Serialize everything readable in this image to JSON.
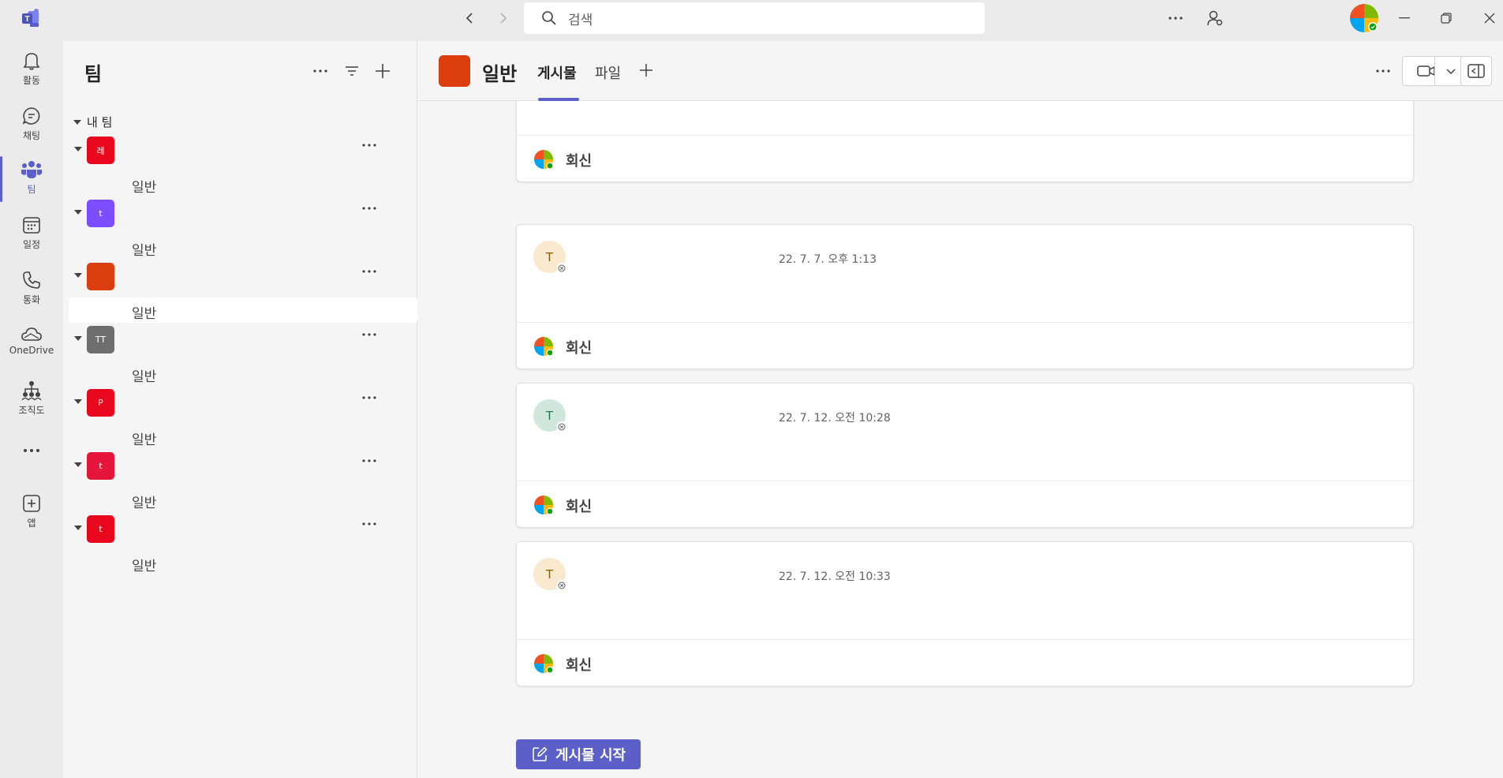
{
  "titlebar": {
    "search_placeholder": "검색"
  },
  "rail": {
    "items": [
      {
        "label": "활동",
        "icon": "bell-icon"
      },
      {
        "label": "채팅",
        "icon": "chat-icon"
      },
      {
        "label": "팀",
        "icon": "teams-icon"
      },
      {
        "label": "일정",
        "icon": "calendar-icon"
      },
      {
        "label": "통화",
        "icon": "phone-icon"
      },
      {
        "label": "OneDrive",
        "icon": "cloud-icon"
      },
      {
        "label": "조직도",
        "icon": "org-chart-icon"
      },
      {
        "label": "",
        "icon": "more-icon"
      },
      {
        "label": "앱",
        "icon": "add-app-icon"
      }
    ],
    "active_index": 2,
    "accent_color": "#5b5fc7"
  },
  "teams_panel": {
    "title": "팀",
    "section_label": "내 팀",
    "teams": [
      {
        "initials": "레",
        "color": "#e8071c",
        "channel": "일반"
      },
      {
        "initials": "t",
        "color": "#7c4dff",
        "channel": "일반"
      },
      {
        "initials": "",
        "color": "#dc3d0e",
        "channel": "일반"
      },
      {
        "initials": "TT",
        "color": "#6e6e6e",
        "channel": "일반"
      },
      {
        "initials": "P",
        "color": "#e8071c",
        "channel": "일반"
      },
      {
        "initials": "t",
        "color": "#e5153c",
        "channel": "일반"
      },
      {
        "initials": "t",
        "color": "#e8071c",
        "channel": "일반"
      }
    ],
    "selected_team_index": 2
  },
  "channel": {
    "name": "일반",
    "tabs": [
      {
        "label": "게시물",
        "active": true
      },
      {
        "label": "파일",
        "active": false
      }
    ]
  },
  "posts": [
    {
      "avatar": "",
      "avatar_bg": "#cfe7dd",
      "time": "",
      "reply": "회신"
    },
    {
      "avatar": "T",
      "avatar_bg": "#f9e9cf",
      "time": "22. 7. 7. 오후 1:13",
      "reply": "회신"
    },
    {
      "avatar": "T",
      "avatar_bg": "#cfe7dd",
      "time": "22. 7. 12. 오전 10:28",
      "reply": "회신"
    },
    {
      "avatar": "T",
      "avatar_bg": "#f9e9cf",
      "time": "22. 7. 12. 오전 10:33",
      "reply": "회신"
    }
  ],
  "new_post_button": "게시물 시작"
}
